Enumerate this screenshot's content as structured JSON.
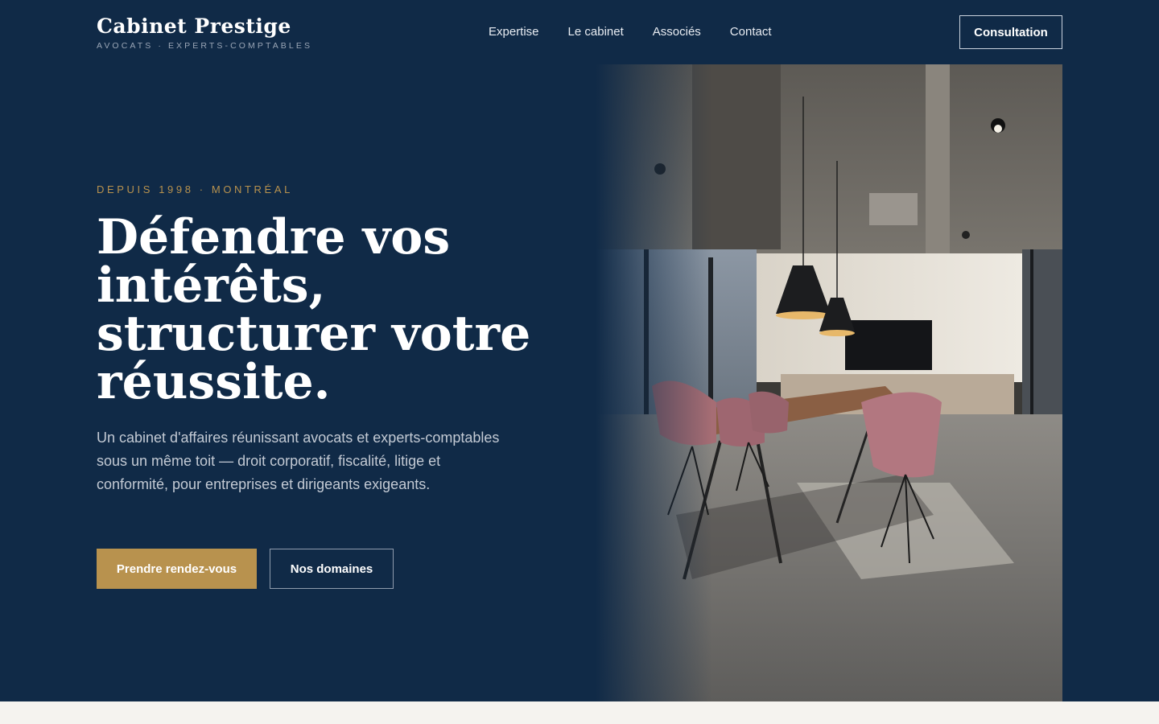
{
  "brand": {
    "name": "Cabinet Prestige",
    "tagline": "AVOCATS · EXPERTS-COMPTABLES"
  },
  "nav": {
    "items": [
      {
        "label": "Expertise"
      },
      {
        "label": "Le cabinet"
      },
      {
        "label": "Associés"
      },
      {
        "label": "Contact"
      }
    ],
    "cta_label": "Consultation"
  },
  "hero": {
    "eyebrow": "DEPUIS 1998 · MONTRÉAL",
    "headline_lines": [
      "Défendre vos",
      "intérêts,",
      "structurer votre",
      "réussite."
    ],
    "lead": "Un cabinet d'affaires réunissant avocats et experts-comptables sous un même toit — droit corporatif, fiscalité, litige et conformité, pour entreprises et dirigeants exigeants.",
    "primary_button": "Prendre rendez-vous",
    "secondary_button": "Nos domaines",
    "image_subject": "modern-conference-room-photo"
  },
  "colors": {
    "navy": "#102a47",
    "gold": "#b8924e",
    "light_band": "#f5f3ef"
  }
}
